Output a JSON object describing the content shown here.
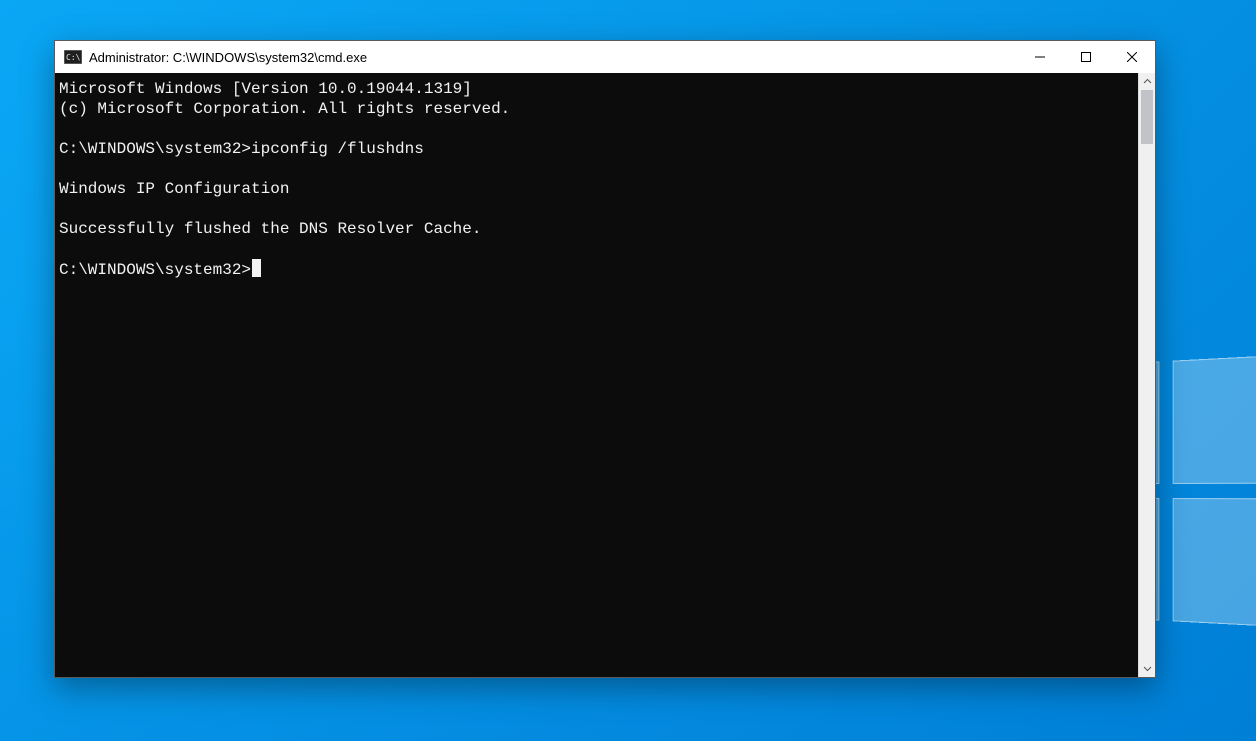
{
  "window": {
    "title": "Administrator: C:\\WINDOWS\\system32\\cmd.exe"
  },
  "console": {
    "lines": [
      "Microsoft Windows [Version 10.0.19044.1319]",
      "(c) Microsoft Corporation. All rights reserved.",
      "",
      "C:\\WINDOWS\\system32>ipconfig /flushdns",
      "",
      "Windows IP Configuration",
      "",
      "Successfully flushed the DNS Resolver Cache.",
      "",
      "C:\\WINDOWS\\system32>"
    ],
    "prompt_index": 9
  },
  "colors": {
    "console_bg": "#0c0c0c",
    "console_fg": "#f2f2f2",
    "desktop_bg": "#0099e5"
  }
}
